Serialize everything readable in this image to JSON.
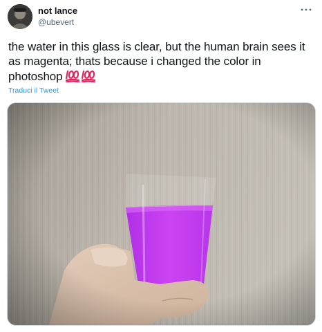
{
  "tweet": {
    "author": {
      "display_name": "not lance",
      "handle": "@ubevert"
    },
    "text": "the water in this glass is clear, but the human brain sees it as magenta; thats because i changed the color in photoshop",
    "emoji": [
      "hundred-points-emoji",
      "hundred-points-emoji"
    ],
    "translate_label": "Traduci il Tweet",
    "media": {
      "icon": "photo"
    },
    "more_icon": "more-horizontal-icon"
  },
  "colors": {
    "text": "#0f1419",
    "secondary": "#536471",
    "link": "#1d9bf0",
    "liquid": "#c03cf0",
    "emoji": "#e0245e"
  }
}
